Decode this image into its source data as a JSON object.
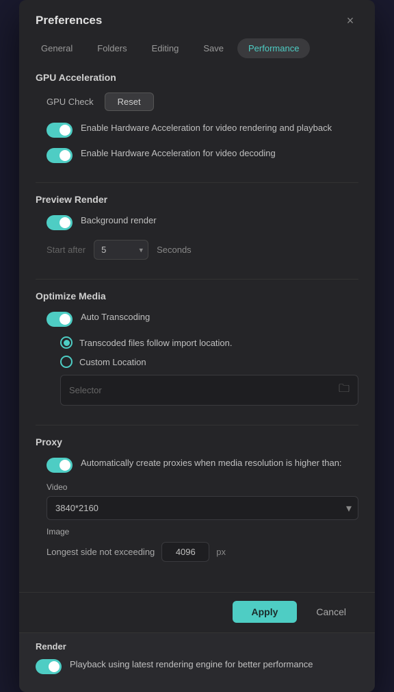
{
  "dialog": {
    "title": "Preferences",
    "close_label": "×"
  },
  "tabs": [
    {
      "id": "general",
      "label": "General",
      "active": false
    },
    {
      "id": "folders",
      "label": "Folders",
      "active": false
    },
    {
      "id": "editing",
      "label": "Editing",
      "active": false
    },
    {
      "id": "save",
      "label": "Save",
      "active": false
    },
    {
      "id": "performance",
      "label": "Performance",
      "active": true
    }
  ],
  "sections": {
    "gpu_acceleration": {
      "title": "GPU Acceleration",
      "gpu_check_label": "GPU Check",
      "reset_label": "Reset",
      "toggle1_label": "Enable Hardware Acceleration for video rendering and playback",
      "toggle2_label": "Enable Hardware Acceleration for video decoding"
    },
    "preview_render": {
      "title": "Preview Render",
      "bg_render_label": "Background render",
      "start_after_label": "Start after",
      "seconds_value": "5",
      "seconds_label": "Seconds"
    },
    "optimize_media": {
      "title": "Optimize Media",
      "auto_transcoding_label": "Auto Transcoding",
      "radio1_label": "Transcoded files follow import location.",
      "radio2_label": "Custom Location",
      "selector_placeholder": "Selector"
    },
    "proxy": {
      "title": "Proxy",
      "toggle_label": "Automatically create proxies when media resolution is higher than:",
      "video_label": "Video",
      "video_value": "3840*2160",
      "image_label": "Image",
      "image_side_label": "Longest side not exceeding",
      "image_value": "4096",
      "image_unit": "px"
    },
    "render": {
      "title": "Render",
      "toggle_label": "Playback using latest rendering engine for better performance"
    }
  },
  "footer": {
    "apply_label": "Apply",
    "cancel_label": "Cancel"
  },
  "icons": {
    "folder": "🗀",
    "close": "✕",
    "chevron_down": "▾"
  }
}
